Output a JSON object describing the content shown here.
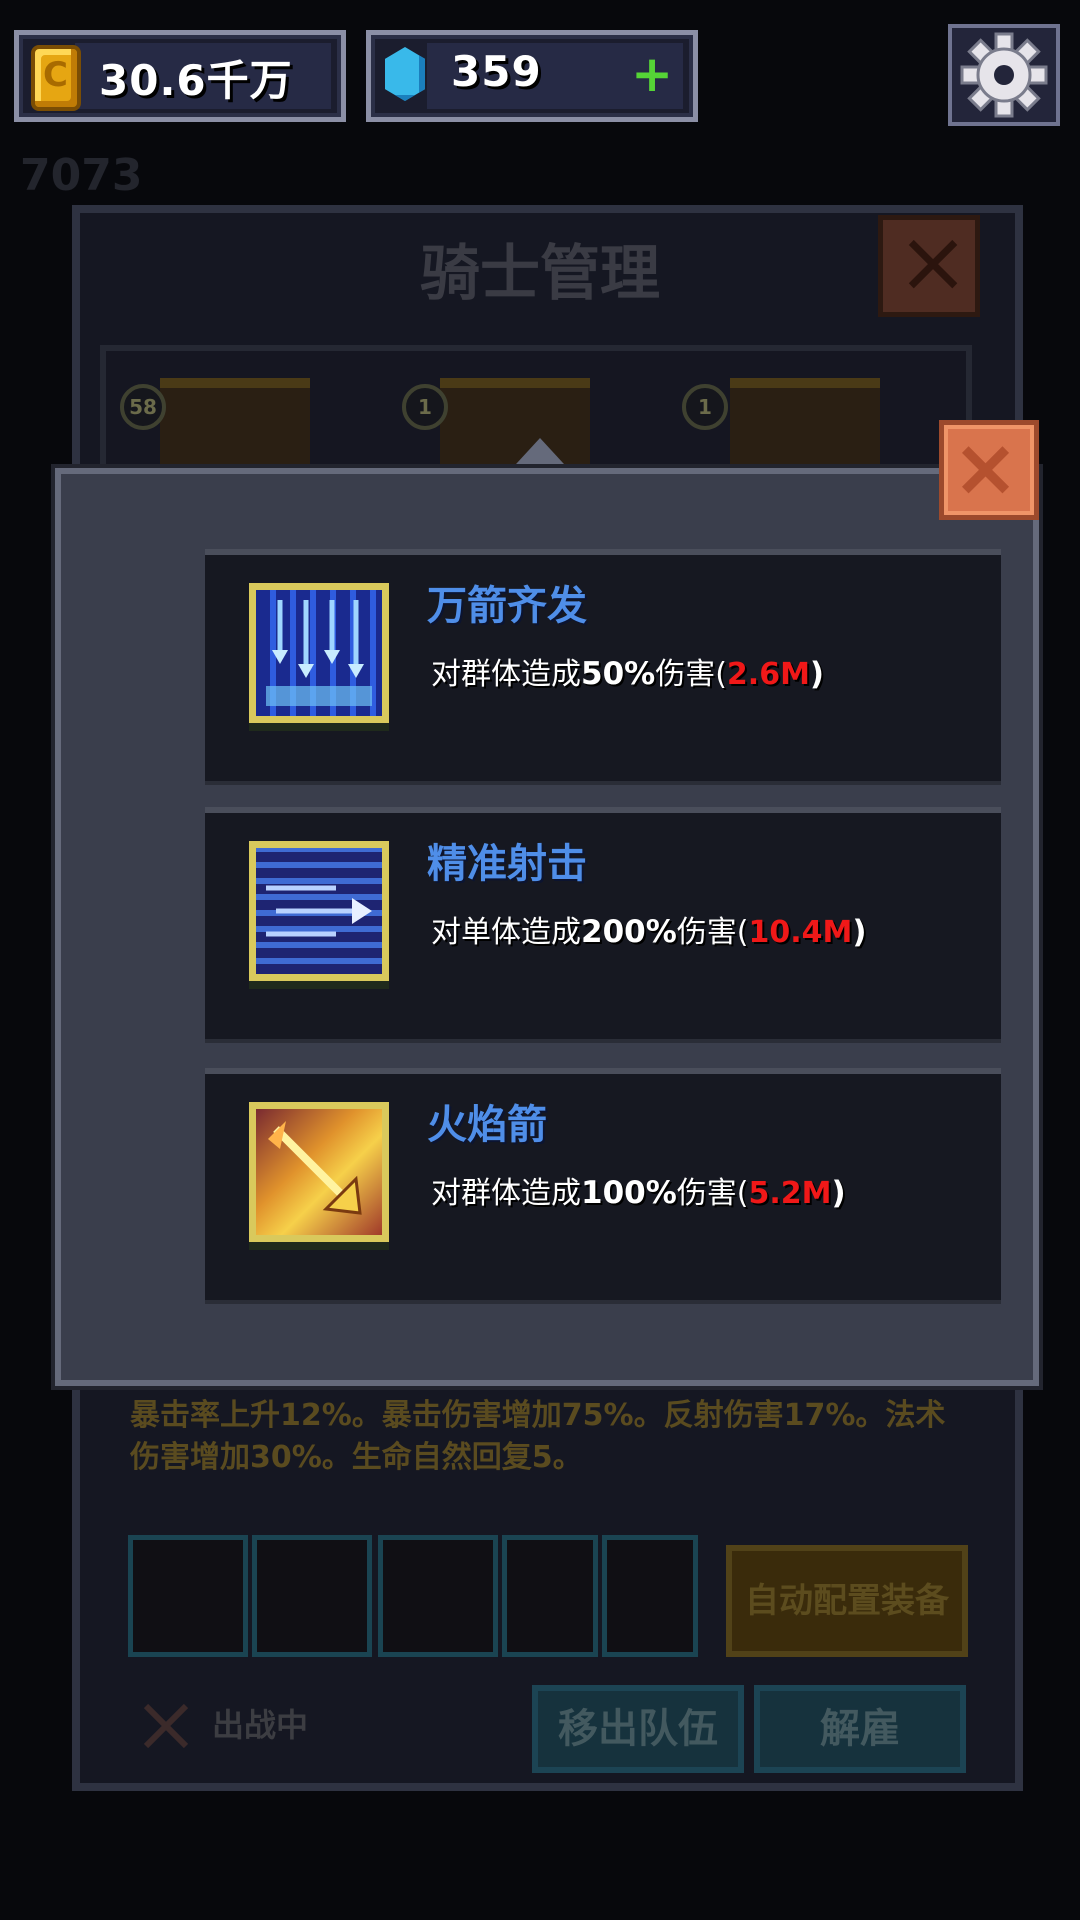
{
  "top_bar": {
    "gold_amount": "30.6千万",
    "gem_amount": "359",
    "gem_add_label": "+",
    "coin_glyph": "C",
    "settings_icon": "gear-icon"
  },
  "background": {
    "title": "骑士管理",
    "behind_popup_number": "7073",
    "knight_levels": [
      "58",
      "1",
      "1"
    ],
    "description": "暴击率上升12%。暴击伤害增加75%。反射伤害17%。法术伤害增加30%。生命自然回复5。",
    "auto_equip_label": "自动配置装备",
    "status_label": "出战中",
    "remove_team_label": "移出队伍",
    "dismiss_label": "解雇"
  },
  "popup": {
    "close_icon": "close-icon",
    "skills": [
      {
        "name": "万箭齐发",
        "desc_prefix": "对群体造成",
        "percent": "50%",
        "desc_suffix": "伤害(",
        "damage": "2.6M",
        "close_paren": ")",
        "icon": "arrow-rain-icon"
      },
      {
        "name": "精准射击",
        "desc_prefix": "对单体造成",
        "percent": "200%",
        "desc_suffix": "伤害(",
        "damage": "10.4M",
        "close_paren": ")",
        "icon": "precise-shot-icon"
      },
      {
        "name": "火焰箭",
        "desc_prefix": "对群体造成",
        "percent": "100%",
        "desc_suffix": "伤害(",
        "damage": "5.2M",
        "close_paren": ")",
        "icon": "fire-arrow-icon"
      }
    ]
  },
  "colors": {
    "skill_name": "#4f8ee8",
    "damage_value": "#f01818",
    "icon_frame": "#d9c95c",
    "close_button": "#d9744d"
  }
}
